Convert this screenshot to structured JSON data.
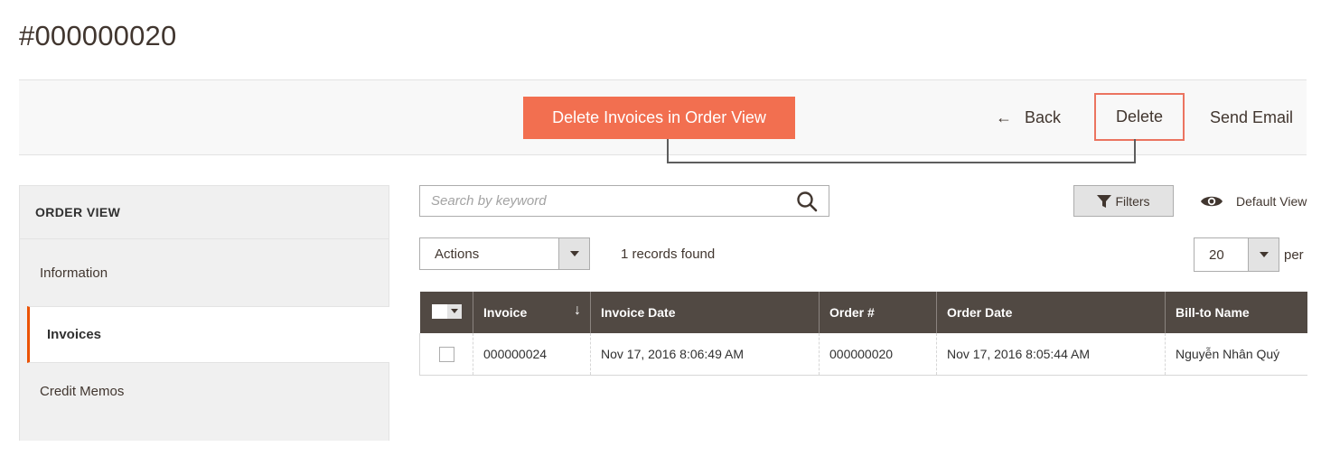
{
  "page": {
    "title": "#000000020"
  },
  "callout": {
    "text": "Delete Invoices in Order View",
    "color": "#f26f50"
  },
  "toolbar": {
    "back_label": "Back",
    "delete_label": "Delete",
    "send_email_label": "Send Email",
    "highlight_color": "#eb7460"
  },
  "sidebar": {
    "title": "ORDER VIEW",
    "items": [
      {
        "label": "Information",
        "active": false
      },
      {
        "label": "Invoices",
        "active": true
      },
      {
        "label": "Credit Memos",
        "active": false
      }
    ],
    "active_color": "#eb5202"
  },
  "grid_controls": {
    "search_placeholder": "Search by keyword",
    "search_value": "",
    "filters_label": "Filters",
    "view_label": "Default View",
    "actions_label": "Actions",
    "records_found": "1 records found",
    "per_page_value": "20",
    "per_page_suffix": "per"
  },
  "grid": {
    "columns": [
      "Invoice",
      "Invoice Date",
      "Order #",
      "Order Date",
      "Bill-to Name"
    ],
    "sorted_column": "Invoice",
    "header_color": "#514943",
    "rows": [
      {
        "invoice": "000000024",
        "invoice_date": "Nov 17, 2016 8:06:49 AM",
        "order_number": "000000020",
        "order_date": "Nov 17, 2016 8:05:44 AM",
        "bill_to_name": "Nguyễn Nhân Quý"
      }
    ]
  }
}
